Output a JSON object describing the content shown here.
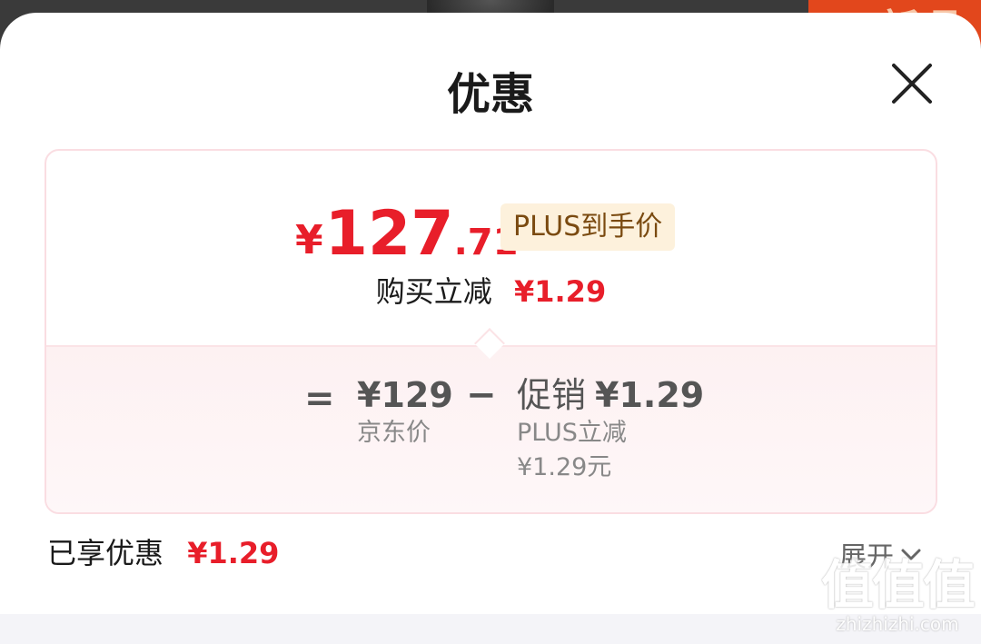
{
  "backdrop": {
    "banner_text": "新品"
  },
  "sheet": {
    "title": "优惠",
    "close_icon": "close-icon"
  },
  "price_card": {
    "currency": "¥",
    "price_int": "127",
    "price_dec": ".71",
    "price_tag": "PLUS到手价",
    "reduce_label": "购买立减",
    "reduce_value": "¥1.29",
    "breakdown": {
      "equals": "=",
      "jd_value": "¥129",
      "jd_label": "京东价",
      "minus": "−",
      "promo_label": "促销",
      "promo_value": "¥1.29",
      "promo_sub1": "PLUS立减",
      "promo_sub2": "¥1.29元"
    }
  },
  "summary": {
    "enjoyed_label": "已享优惠",
    "enjoyed_value": "¥1.29",
    "expand_label": "展开",
    "expand_icon": "chevron-down-icon"
  },
  "watermark": {
    "logo": "值值值",
    "url": "zhizhizhi.com"
  },
  "colors": {
    "accent_red": "#e81e2a",
    "tag_bg": "#fdf1dc",
    "tag_text": "#7a4a10"
  }
}
